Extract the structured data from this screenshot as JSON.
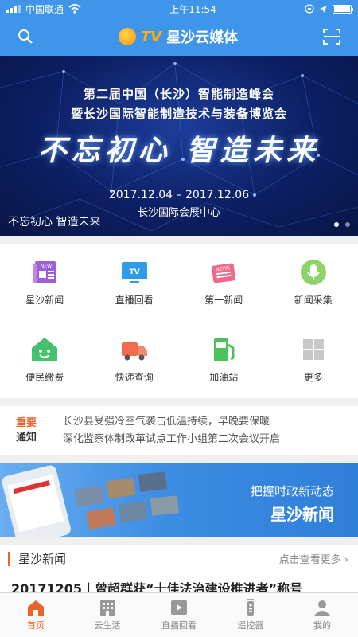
{
  "status": {
    "carrier": "中国联通",
    "time": "上午11:54"
  },
  "header": {
    "logo_tv": "TV",
    "logo_text": "星沙云媒体",
    "search_icon": "search-icon",
    "scan_icon": "scan-icon"
  },
  "banner": {
    "line1": "第二届中国（长沙）智能制造峰会",
    "line2": "暨长沙国际智能制造技术与装备博览会",
    "slogan": "不忘初心 智造未来",
    "dates": "2017.12.04 – 2017.12.06",
    "venue": "长沙国际会展中心",
    "caption": "不忘初心 智造未来"
  },
  "grid": [
    {
      "label": "星沙新闻",
      "icon": "newspaper-icon"
    },
    {
      "label": "直播回看",
      "icon": "tv-icon"
    },
    {
      "label": "第一新闻",
      "icon": "news-icon"
    },
    {
      "label": "新闻采集",
      "icon": "microphone-icon"
    },
    {
      "label": "便民缴费",
      "icon": "house-icon"
    },
    {
      "label": "快递查询",
      "icon": "truck-icon"
    },
    {
      "label": "加油站",
      "icon": "fuel-pump-icon"
    },
    {
      "label": "更多",
      "icon": "grid-icon"
    }
  ],
  "notice": {
    "tag_top": "重要",
    "tag_bottom": "通知",
    "items": [
      "长沙县受强冷空气袭击低温持续，早晚要保暖",
      "深化监察体制改革试点工作小组第二次会议开启"
    ]
  },
  "ad": {
    "line1": "把握时政新动态",
    "line2": "星沙新闻"
  },
  "section": {
    "title": "星沙新闻",
    "more": "点击查看更多",
    "article": "20171205丨曾超群获“十佳法治建设推进者”称号"
  },
  "tabs": [
    {
      "label": "首页",
      "icon": "home-icon",
      "active": true
    },
    {
      "label": "云生活",
      "icon": "building-icon"
    },
    {
      "label": "直播回看",
      "icon": "play-icon"
    },
    {
      "label": "遥控器",
      "icon": "remote-icon"
    },
    {
      "label": "我的",
      "icon": "person-icon"
    }
  ],
  "colors": {
    "brand_blue": "#3f95ea",
    "accent_orange": "#e8642c"
  }
}
